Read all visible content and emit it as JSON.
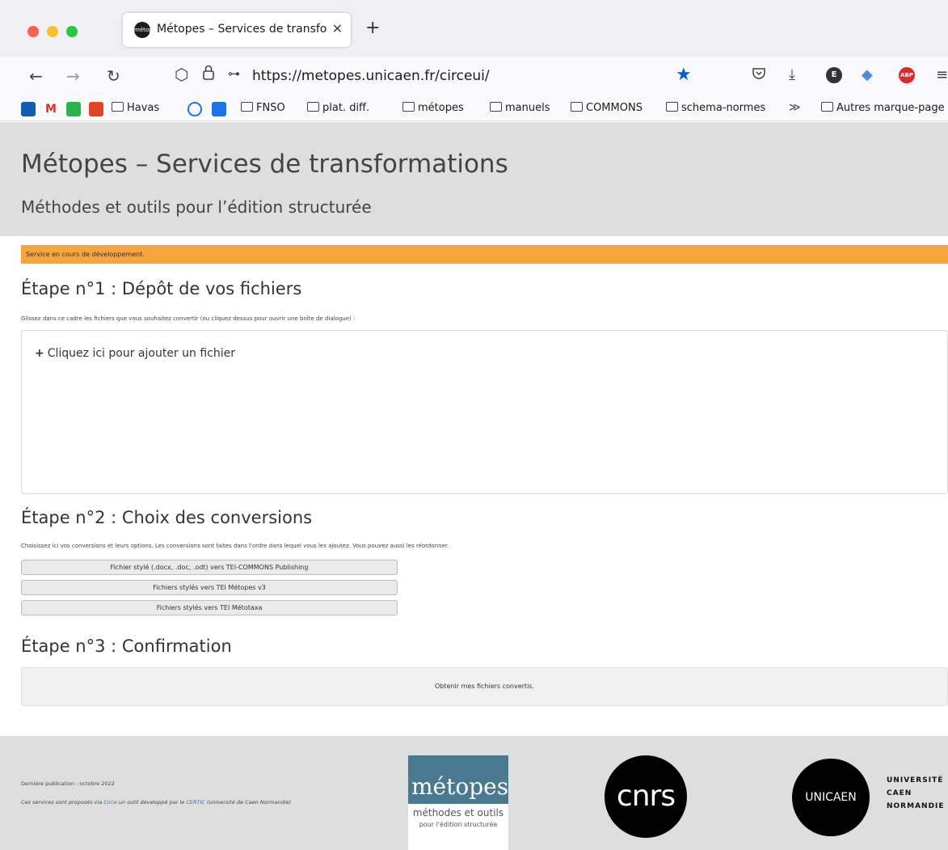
{
  "browser": {
    "tab_title": "Métopes – Services de transforr",
    "tab_favicon": "métopes",
    "url": "https://metopes.unicaen.fr/circeui/",
    "icons": {
      "back": "←",
      "forward": "→",
      "reload": "C",
      "shield": "⬡",
      "lock": "🔒",
      "perm": "⊶",
      "star": "★",
      "pocket": "◉",
      "download": "⤓",
      "menu": "≡",
      "ext_e": "E",
      "ext_abp": "ABP"
    },
    "bookmarks": {
      "items": [
        "Havas",
        "FNSO",
        "plat. diff.",
        "métopes",
        "manuels",
        "COMMONS",
        "schema-normes",
        "Autres marque-page"
      ],
      "more": "≫"
    }
  },
  "page": {
    "title": "Métopes – Services de transformations",
    "subtitle": "Méthodes et outils pour l’édition structurée",
    "alert": "Service en cours de développement.",
    "step1": {
      "title": "Étape n°1 : Dépôt de vos fichiers",
      "desc": "Glissez dans ce cadre les fichiers que vous souhaitez convertir (ou cliquez dessus pour ouvrir une boîte de dialogue) :",
      "add_file": "Cliquez ici pour ajouter un fichier",
      "plus": "+"
    },
    "step2": {
      "title": "Étape n°2 : Choix des conversions",
      "desc": "Choisissez ici vos conversions et leurs options. Les conversions sont faites dans l'ordre dans lequel vous les ajoutez. Vous pouvez aussi les réordonner.",
      "conversions": [
        "Fichier stylé (.docx, .doc, .odt) vers TEI-COMMONS Publishing",
        "Fichiers stylés vers TEI Métopes v3",
        "Fichiers stylés vers TEI Métotaxa"
      ]
    },
    "step3": {
      "title": "Étape n°3 : Confirmation",
      "button": "Obtenir mes fichiers convertis."
    }
  },
  "footer": {
    "last_pub": "Dernière publication : octobre 2022",
    "credit_pre": "Ces services sont proposés via ",
    "credit_circe": "Circe",
    "credit_mid": " un outil développé par le ",
    "credit_certic": "CERTIC",
    "credit_post": " (université de Caen Normandie)",
    "metopes_logo": "métopes",
    "metopes_sub1": "méthodes et outils",
    "metopes_sub2": "pour l'édition structurée",
    "cnrs_logo": "cnrs",
    "unicaen_logo": "UNICAEN",
    "unicaen_line1": "UNIVERSITÉ",
    "unicaen_line2": "CAEN",
    "unicaen_line3": "NORMANDIE"
  }
}
